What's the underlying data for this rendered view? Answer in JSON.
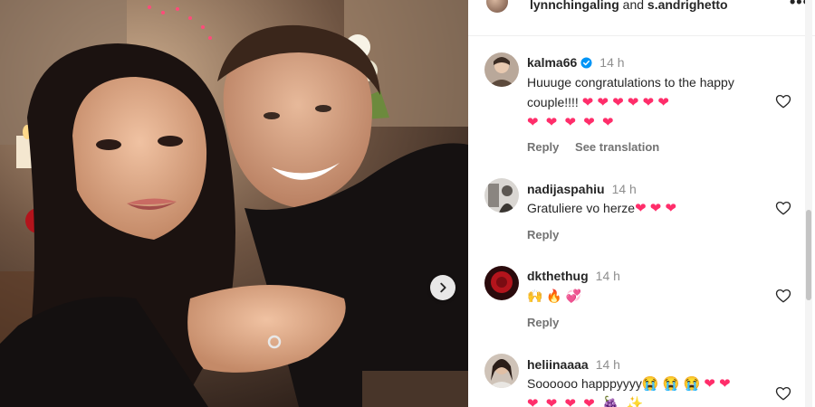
{
  "header": {
    "user1": "lynnchingaling",
    "conj": "and",
    "user2": "s.andrighetto",
    "more": "•••"
  },
  "comments": [
    {
      "username": "kalma66",
      "verified": true,
      "time": "14 h",
      "text": "Huuuge congratulations to the happy couple!!!!",
      "emoji_line1": "❤ ❤ ❤ ❤ ❤ ❤",
      "emoji_line2": "❤ ❤ ❤ ❤ ❤",
      "reply": "Reply",
      "translate": "See translation"
    },
    {
      "username": "nadijaspahiu",
      "time": "14 h",
      "text": "Gratuliere vo herze",
      "emoji_inline": "❤ ❤ ❤",
      "reply": "Reply"
    },
    {
      "username": "dkthethug",
      "time": "14 h",
      "emoji_text": "🙌 🔥 💞",
      "reply": "Reply"
    },
    {
      "username": "heliinaaaa",
      "time": "14 h",
      "text": "Soooooo happpyyyy",
      "emoji_inline": "😭 😭 😭 ❤ ❤",
      "emoji_line2": "❤ ❤ ❤ ❤ 🍇 ✨"
    }
  ],
  "colors": {
    "heart": "#ff2d6a",
    "verified": "#0095f6",
    "muted": "#737373"
  },
  "icons": {
    "next": "chevron-right-icon",
    "like": "heart-outline-icon",
    "verified": "verified-badge-icon"
  }
}
